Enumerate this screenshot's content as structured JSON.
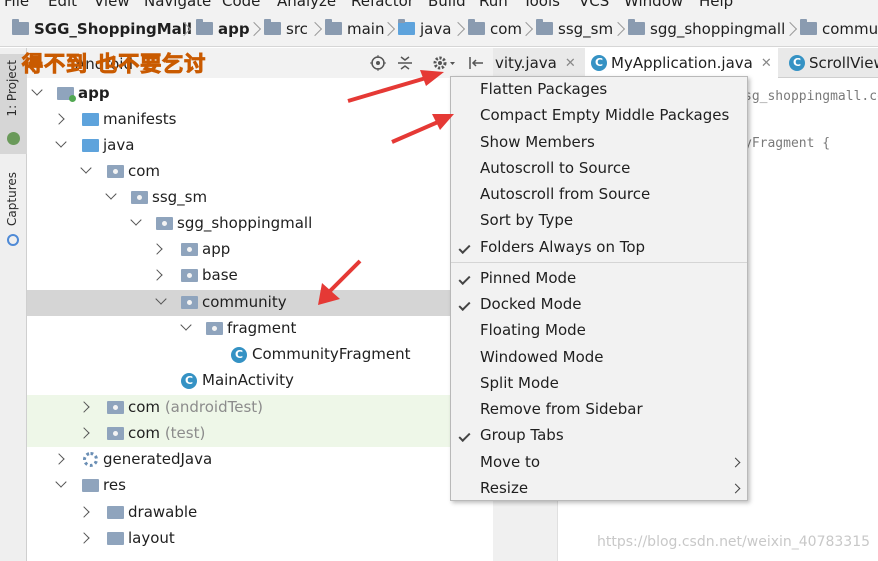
{
  "menubar": {
    "items": [
      "File",
      "Edit",
      "View",
      "Navigate",
      "Code",
      "Analyze",
      "Refactor",
      "Build",
      "Run",
      "Tools",
      "VCS",
      "Window",
      "Help"
    ]
  },
  "breadcrumb": {
    "project": "SGG_ShoppingMall",
    "items": [
      "app",
      "src",
      "main",
      "java",
      "com",
      "ssg_sm",
      "sgg_shoppingmall",
      "commu"
    ]
  },
  "side_tabs": {
    "project": "1: Project",
    "captures": "Captures"
  },
  "overlay_text": "得不到 也不要乞讨",
  "panel": {
    "view_label": "Android",
    "icons": [
      "locate-icon",
      "collapse-icon",
      "settings-gear-icon",
      "hide-panel-icon"
    ]
  },
  "tree": [
    {
      "label": "app",
      "level": 0,
      "state": "open"
    },
    {
      "label": "manifests",
      "level": 1,
      "state": "closed"
    },
    {
      "label": "java",
      "level": 1,
      "state": "open"
    },
    {
      "label": "com",
      "level": 2,
      "state": "open"
    },
    {
      "label": "ssg_sm",
      "level": 3,
      "state": "open"
    },
    {
      "label": "sgg_shoppingmall",
      "level": 4,
      "state": "open"
    },
    {
      "label": "app",
      "level": 5,
      "state": "closed"
    },
    {
      "label": "base",
      "level": 5,
      "state": "closed"
    },
    {
      "label": "community",
      "level": 5,
      "state": "open",
      "selected": true
    },
    {
      "label": "fragment",
      "level": 6,
      "state": "open"
    },
    {
      "label": "CommunityFragment",
      "level": 7,
      "state": "leaf"
    },
    {
      "label": "MainActivity",
      "level": 6,
      "state": "leaf"
    },
    {
      "label": "com",
      "suffix": "(androidTest)",
      "level": 2,
      "state": "closed"
    },
    {
      "label": "com",
      "suffix": "(test)",
      "level": 2,
      "state": "closed"
    },
    {
      "label": "generatedJava",
      "level": 1,
      "state": "closed"
    },
    {
      "label": "res",
      "level": 1,
      "state": "open"
    },
    {
      "label": "drawable",
      "level": 2,
      "state": "closed"
    },
    {
      "label": "layout",
      "level": 2,
      "state": "closed"
    }
  ],
  "editor": {
    "tabs": [
      {
        "label": "vity.java",
        "closable": true
      },
      {
        "label": "MyApplication.java",
        "closable": true
      },
      {
        "label": "ScrollView",
        "closable": false
      }
    ],
    "code_lines": [
      "sg_shoppingmall.co",
      "yFragment {"
    ]
  },
  "context_menu": {
    "items": [
      {
        "label": "Flatten Packages",
        "checked": false
      },
      {
        "label": "Compact Empty Middle Packages",
        "checked": false
      },
      {
        "label": "Show Members",
        "checked": false
      },
      {
        "label": "Autoscroll to Source",
        "checked": false
      },
      {
        "label": "Autoscroll from Source",
        "checked": false
      },
      {
        "label": "Sort by Type",
        "checked": false
      },
      {
        "label": "Folders Always on Top",
        "checked": true
      },
      {
        "label": "Pinned Mode",
        "checked": true
      },
      {
        "label": "Docked Mode",
        "checked": true
      },
      {
        "label": "Floating Mode",
        "checked": false
      },
      {
        "label": "Windowed Mode",
        "checked": false
      },
      {
        "label": "Split Mode",
        "checked": false
      },
      {
        "label": "Remove from Sidebar",
        "checked": false
      },
      {
        "label": "Group Tabs",
        "checked": true
      },
      {
        "label": "Move to",
        "checked": false,
        "submenu": true
      },
      {
        "label": "Resize",
        "checked": false,
        "submenu": true
      }
    ]
  },
  "watermark": "https://blog.csdn.net/weixin_40783315",
  "colors": {
    "selection": "#d5d5d5",
    "test_bg": "#eef7e8",
    "arrow": "#e53935",
    "class_icon": "#3592c4"
  }
}
